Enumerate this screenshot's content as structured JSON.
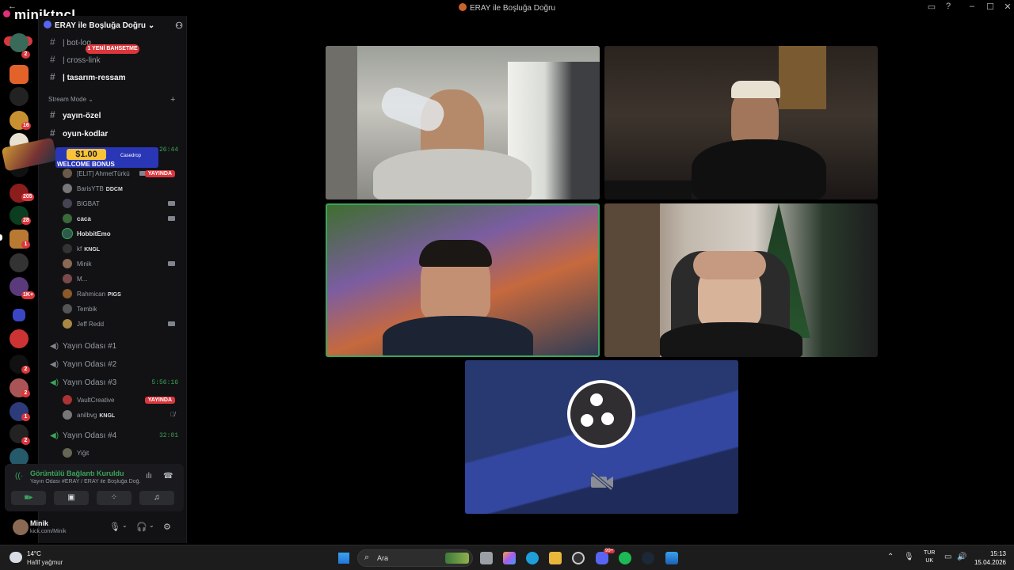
{
  "window": {
    "title": "ERAY ile Boşluğa Doğru"
  },
  "overlay": {
    "streamer_name": "miniktncl"
  },
  "guild_bar": {
    "new_label": "YENİ",
    "badges": [
      "2",
      "16",
      "205",
      "28",
      "1",
      "1K+",
      "2",
      "2",
      "1",
      "2",
      "2"
    ]
  },
  "server": {
    "name": "ERAY ile Boşluğa Doğru"
  },
  "mention_pill": "1 YENİ BAHSETME",
  "channels_top": [
    {
      "name": "bot-log",
      "prefix": "| "
    },
    {
      "name": "cross-link",
      "prefix": "| "
    },
    {
      "name": "tasarım-ressam",
      "prefix": "| "
    }
  ],
  "section_stream_mode": "Stream Mode",
  "channels_stream": [
    {
      "name": "yayın-özel"
    },
    {
      "name": "oyun-kodlar"
    }
  ],
  "voice_room1_time": "26:44",
  "ad": {
    "price": "$1.00",
    "text": "WELCOME BONUS",
    "brand": "Casedrop"
  },
  "voice_users_room1": [
    {
      "name": "[ELIT] AhmetTürkü",
      "tag": "",
      "live": "YAYINDA"
    },
    {
      "name": "BarisYTB",
      "tag": "DDCM",
      "live": ""
    },
    {
      "name": "BIGBAT",
      "tag": "",
      "live": ""
    },
    {
      "name": "caca",
      "tag": "",
      "live": ""
    },
    {
      "name": "HobbitEmo",
      "tag": "",
      "live": ""
    },
    {
      "name": "kf",
      "tag": "KNGL",
      "live": ""
    },
    {
      "name": "Minik",
      "tag": "",
      "live": ""
    },
    {
      "name": "M...",
      "tag": "",
      "live": ""
    },
    {
      "name": "Rahmican",
      "tag": "PIGS",
      "live": ""
    },
    {
      "name": "Tembik",
      "tag": "",
      "live": ""
    },
    {
      "name": "Jeff Redd",
      "tag": "",
      "live": ""
    }
  ],
  "voice_rooms": [
    {
      "name": "Yayın Odası #1",
      "time": ""
    },
    {
      "name": "Yayın Odası #2",
      "time": ""
    },
    {
      "name": "Yayın Odası #3",
      "time": "5:56:16"
    },
    {
      "name": "Yayın Odası #4",
      "time": "32:01"
    }
  ],
  "voice_users_room3": [
    {
      "name": "VaultCreative",
      "tag": "",
      "live": "YAYINDA"
    },
    {
      "name": "anilbvg",
      "tag": "KNGL",
      "live": ""
    }
  ],
  "voice_users_room4": [
    {
      "name": "Yiğit"
    }
  ],
  "voice_panel": {
    "status": "Görüntülü Bağlantı Kuruldu",
    "subtitle": "Yayın Odası #ERAY / ERAY ile Boşluğa Doğ..."
  },
  "user_panel": {
    "name": "Minik",
    "status": "kick.com/Minik"
  },
  "taskbar": {
    "temperature": "14°C",
    "condition": "Hafif yağmur",
    "search_placeholder": "Ara",
    "lang_line1": "TUR",
    "lang_line2": "UK",
    "time": "15:13",
    "date": "15.04.2026",
    "notif_badge": "99+"
  },
  "icons": [
    "search-icon",
    "camera-icon",
    "screen-share-icon",
    "activities-icon",
    "soundboard-icon",
    "mic-icon",
    "headphones-icon",
    "gear-icon",
    "obs-logo-icon",
    "camera-off-icon"
  ],
  "colors": {
    "accent": "#5865f2",
    "live_red": "#da373c",
    "voice_green": "#3ba55c",
    "obs_bg": "#283870"
  }
}
